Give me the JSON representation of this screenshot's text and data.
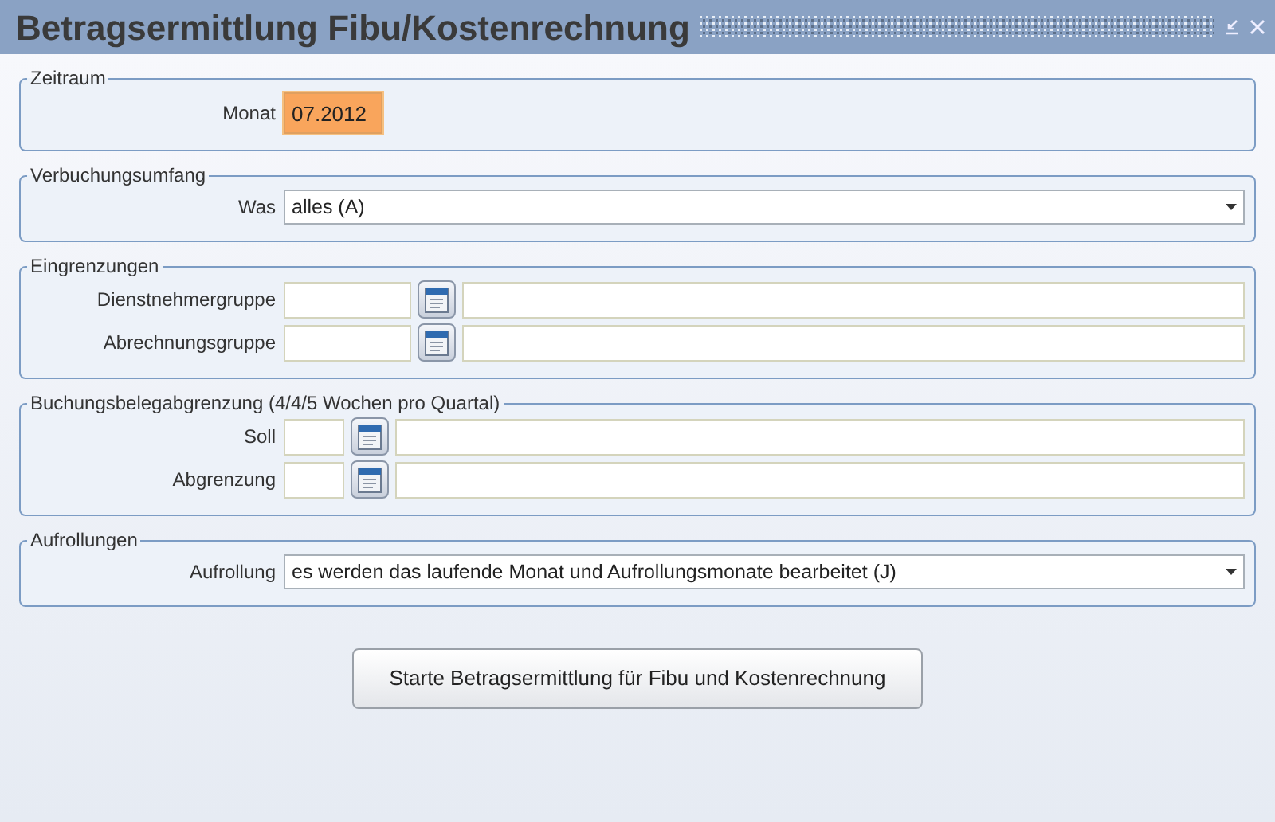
{
  "window": {
    "title": "Betragsermittlung Fibu/Kostenrechnung"
  },
  "groups": [
    {
      "title": "Zeitraum",
      "rows": [
        {
          "kind": "text",
          "label": "Monat",
          "value": "07.2012",
          "focused": true
        }
      ]
    },
    {
      "title": "Verbuchungsumfang",
      "rows": [
        {
          "kind": "select",
          "label": "Was",
          "value": "alles (A)"
        }
      ]
    },
    {
      "title": "Eingrenzungen",
      "rows": [
        {
          "kind": "lookup",
          "label": "Dienstnehmergruppe"
        },
        {
          "kind": "lookup",
          "label": "Abrechnungsgruppe"
        }
      ]
    },
    {
      "title": "Buchungsbelegabgrenzung (4/4/5 Wochen pro Quartal)",
      "rows": [
        {
          "kind": "short_lookup",
          "label": "Soll"
        },
        {
          "kind": "short_lookup",
          "label": "Abgrenzung"
        }
      ]
    },
    {
      "title": "Aufrollungen",
      "rows": [
        {
          "kind": "select",
          "label": "Aufrollung",
          "value": "es werden das laufende Monat und Aufrollungsmonate bearbeitet (J)"
        }
      ]
    }
  ],
  "start_button": {
    "label": "Starte Betragsermittlung für Fibu und Kostenrechnung"
  }
}
